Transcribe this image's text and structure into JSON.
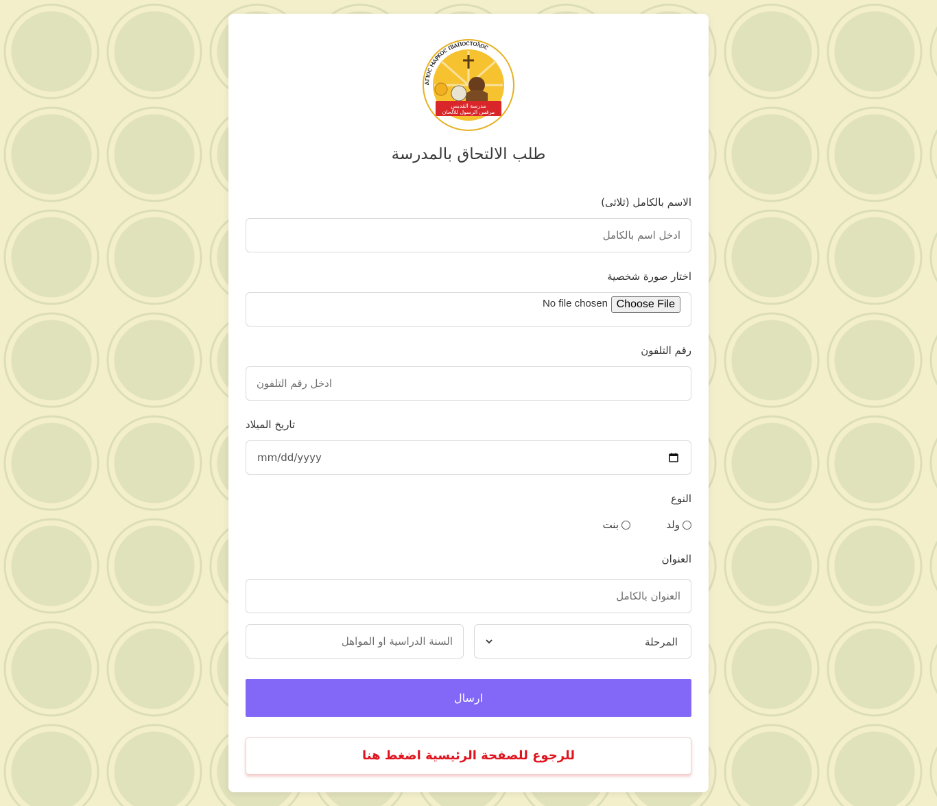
{
  "logo": {
    "ring_text": "ⲀⲄⲒⲞⲤ ⲘⲀⲢⲔⲞⲤ ⲠⲒⲀⲠⲞⲤⲦⲞⲖⲞⲤ",
    "banner_line1": "مدرسة القديس",
    "banner_line2": "مرقس الرسول للألحان"
  },
  "form": {
    "title": "طلب الالتحاق بالمدرسة",
    "full_name": {
      "label": "الاسم بالكامل (ثلاثى)",
      "placeholder": "ادخل اسم بالكامل"
    },
    "photo": {
      "label": "اختار صورة شخصية",
      "button": "Choose File",
      "status": "No file chosen"
    },
    "phone": {
      "label": "رقم التلفون",
      "placeholder": "ادخل رقم التلفون"
    },
    "birthdate": {
      "label": "تاريخ الميلاد",
      "placeholder": "mm/dd/yyyy"
    },
    "gender": {
      "label": "النوع",
      "option_boy": "ولد",
      "option_girl": "بنت"
    },
    "address": {
      "label": "العنوان",
      "placeholder": "العنوان بالكامل"
    },
    "stage": {
      "selected": "المرحلة"
    },
    "year": {
      "placeholder": "السنة الدراسية او المواهل"
    },
    "submit_label": "ارسال",
    "back_label": "للرجوع للصفحة الرئيسية اضغط هنا"
  },
  "colors": {
    "background": "#f3efcb",
    "submit": "#8368f7",
    "back_text": "#e0141e"
  }
}
